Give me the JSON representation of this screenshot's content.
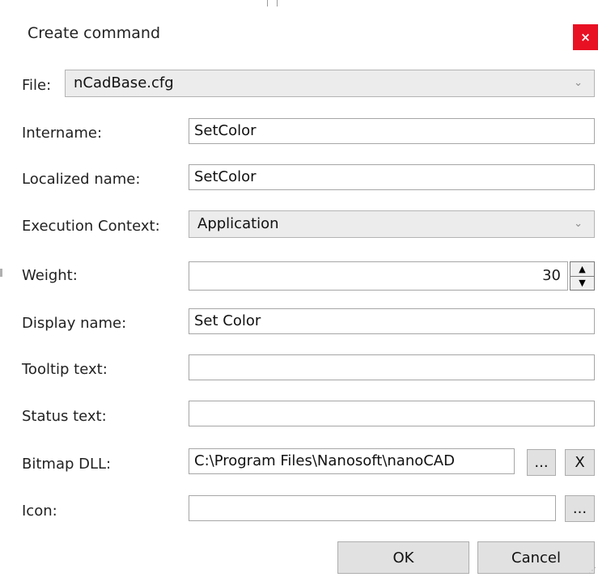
{
  "dialog": {
    "title": "Create command",
    "close_label": "×"
  },
  "file": {
    "label": "File:",
    "value": "nCadBase.cfg"
  },
  "fields": {
    "intername_label": "Intername:",
    "intername_value": "SetColor",
    "localized_label": "Localized name:",
    "localized_value": "SetColor",
    "context_label": "Execution Context:",
    "context_value": "Application",
    "weight_label": "Weight:",
    "weight_value": "30",
    "display_label": "Display name:",
    "display_value": "Set Color",
    "tooltip_label": "Tooltip text:",
    "tooltip_value": "",
    "status_label": "Status text:",
    "status_value": "",
    "bitmap_label": "Bitmap DLL:",
    "bitmap_value": "C:\\Program Files\\Nanosoft\\nanoCAD",
    "icon_label": "Icon:",
    "icon_value": ""
  },
  "buttons": {
    "browse": "...",
    "clear": "X",
    "ok": "OK",
    "cancel": "Cancel"
  },
  "colors": {
    "close_bg": "#e81123",
    "button_bg": "#e1e1e1",
    "combo_bg": "#ececec"
  },
  "icons": {
    "chevron": "chevron-down-icon",
    "spin_up": "spin-up-icon",
    "spin_down": "spin-down-icon",
    "grip": "resize-grip-icon"
  }
}
